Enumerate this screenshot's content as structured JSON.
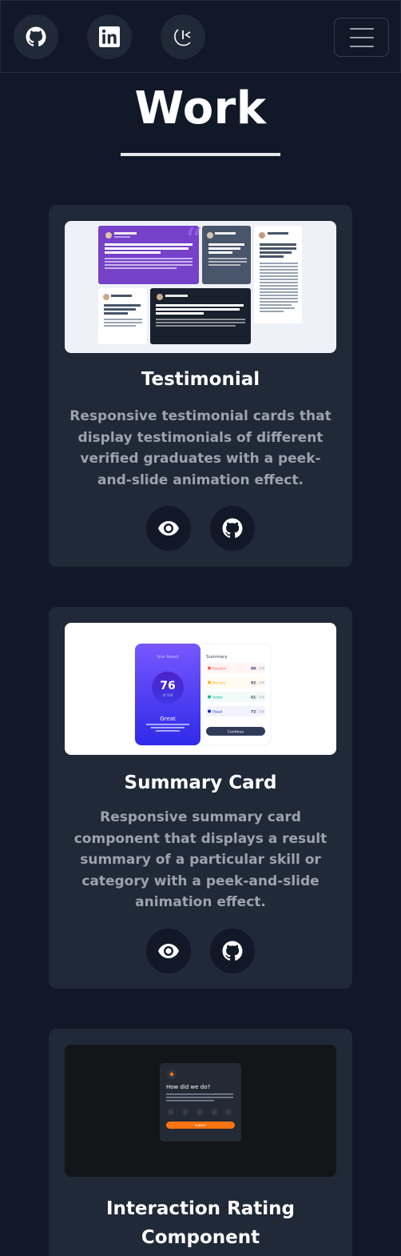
{
  "nav": {
    "social_icons": [
      "github-icon",
      "linkedin-icon",
      "personal-logo-icon"
    ],
    "menu_icon": "hamburger-menu-icon"
  },
  "section": {
    "title": "Work"
  },
  "projects": [
    {
      "title": "Testimonial",
      "description": "Responsive testimonial cards that display testimonials of different verified graduates with a peek-and-slide animation effect.",
      "actions": [
        "eye-icon",
        "github-icon"
      ],
      "thumb": {
        "cards": [
          {
            "name": "Daniel Clifford",
            "role": "Verified Graduate",
            "headline": "I received a job offer mid-course, and the subjects I learned were current, if not more so, in the company I joined. I honestly feel I got every penny's worth."
          },
          {
            "name": "Jonathan Walters",
            "role": "Verified Graduate",
            "headline": "The team was very supportive and kept me motivated"
          },
          {
            "name": "Kira Whittle",
            "role": "Verified Graduate",
            "headline": "Such a life-changing experience. Highly recommended!"
          },
          {
            "name": "Jeanette Harmon",
            "role": "Verified Graduate",
            "headline": "An overall wonderful and rewarding experience"
          },
          {
            "name": "Patrick Abrams",
            "role": "Verified Graduate",
            "headline": "Awesome teaching support from TAs who did the bootcamp themselves. Getting guidance from them and learning from their experiences was easy."
          }
        ]
      }
    },
    {
      "title": "Summary Card",
      "description": "Responsive summary card component that displays a result summary of a particular skill or category with a peek-and-slide animation effect.",
      "actions": [
        "eye-icon",
        "github-icon"
      ],
      "thumb": {
        "result_label": "Your Result",
        "score": "76",
        "score_of": "of 100",
        "verdict": "Great",
        "verdict_text": "You scored higher than 65% of the people who have taken these tests.",
        "summary_label": "Summary",
        "rows": [
          {
            "label": "Reaction",
            "score": "80",
            "of": "/ 100",
            "color": "#ff5757"
          },
          {
            "label": "Memory",
            "score": "92",
            "of": "/ 100",
            "color": "#ffb01f"
          },
          {
            "label": "Verbal",
            "score": "61",
            "of": "/ 100",
            "color": "#00bb8f"
          },
          {
            "label": "Visual",
            "score": "72",
            "of": "/ 100",
            "color": "#1125d4"
          }
        ],
        "button": "Continue"
      }
    },
    {
      "title": "Interaction Rating Component",
      "description": "",
      "thumb": {
        "heading": "How did we do?",
        "body": "Please let us know how we did with your support request. All feedback is appreciated to help us improve our offering!",
        "ratings": [
          "1",
          "2",
          "3",
          "4",
          "5"
        ],
        "button": "SUBMIT"
      }
    }
  ],
  "colors": {
    "background": "#111827",
    "card": "#1f2937",
    "accent_purple": "#7c3aed",
    "accent_orange": "#fb7413"
  }
}
